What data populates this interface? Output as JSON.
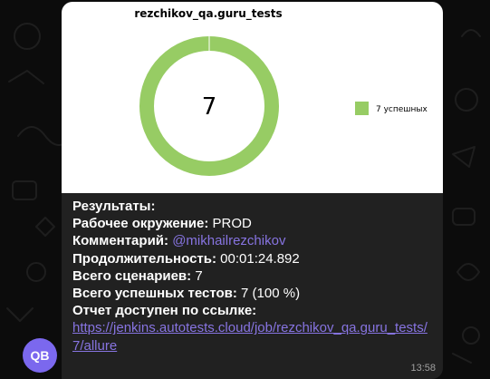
{
  "avatar": {
    "initials": "QB",
    "color": "#7b68ee"
  },
  "chart_data": {
    "type": "pie",
    "title": "rezchikov_qa.guru_tests",
    "center_label": "7",
    "categories": [
      "7 успешных"
    ],
    "values": [
      7
    ],
    "colors": [
      "#97cc64"
    ],
    "legend_position": "right"
  },
  "message": {
    "results_label": "Результаты:",
    "env_label": "Рабочее окружение:",
    "env_value": "PROD",
    "comment_label": "Комментарий:",
    "comment_value": "@mikhailrezchikov",
    "duration_label": "Продолжительность:",
    "duration_value": "00:01:24.892",
    "scenarios_label": "Всего сценариев:",
    "scenarios_value": "7",
    "passed_label": "Всего успешных тестов:",
    "passed_value": "7 (100 %)",
    "report_label": "Отчет доступен по ссылке:",
    "report_link": "https://jenkins.autotests.cloud/job/rezchikov_qa.guru_tests/7/allure",
    "time": "13:58"
  },
  "colors": {
    "accent": "#8774e1",
    "bubble": "#212121",
    "background": "#0c0c0c"
  }
}
